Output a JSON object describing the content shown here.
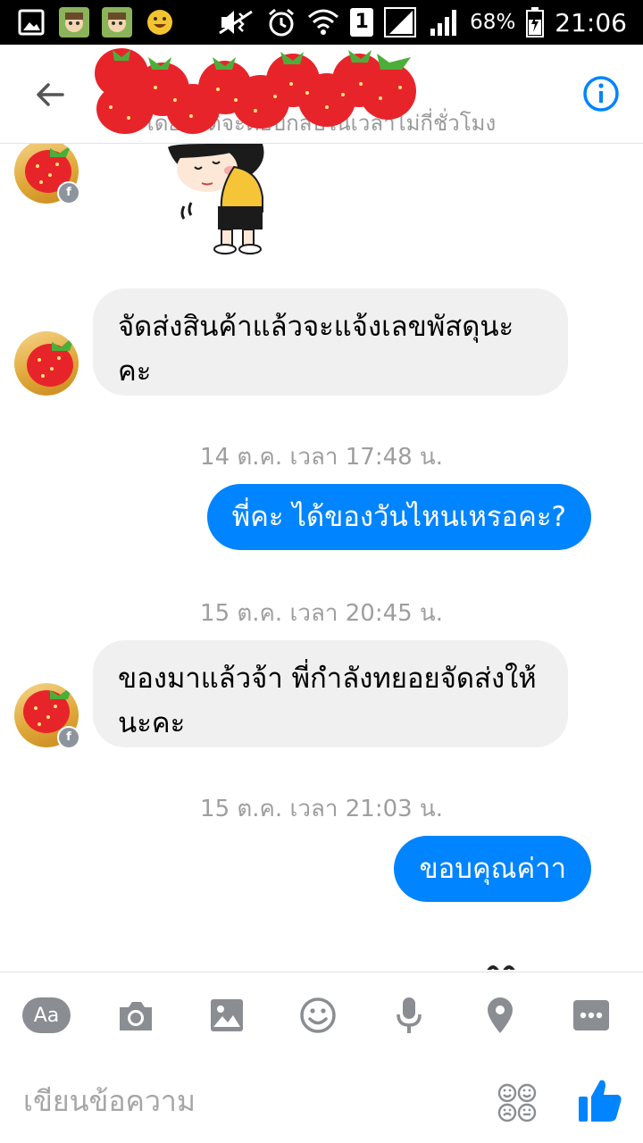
{
  "status_bar": {
    "battery": "68%",
    "time": "21:06",
    "sim": "1"
  },
  "header": {
    "subtitle": "โดยปกติจะตอบกลับในเวลาไม่กี่ชั่วโมง"
  },
  "messages": {
    "m1": "จัดส่งสินค้าแล้วจะแจ้งเลขพัสดุนะคะ",
    "ts1": "14 ต.ค. เวลา 17:48 น.",
    "m2": "พี่คะ ได้ของวันไหนเหรอคะ?",
    "ts2": "15 ต.ค. เวลา 20:45 น.",
    "m3": "ของมาแล้วจ้า พี่กำลังทยอยจัดส่งให้นะคะ",
    "ts3": "15 ต.ค. เวลา 21:03 น.",
    "m4": "ขอบคุณค่าา"
  },
  "composer": {
    "aa_label": "Aa",
    "placeholder": "เขียนข้อความ"
  },
  "colors": {
    "accent": "#0084ff",
    "incoming_bubble": "#f1f0f0",
    "statusbar": "#000000",
    "icon_gray": "#8a8d91"
  },
  "icons": [
    "back-arrow-icon",
    "info-icon",
    "camera-icon",
    "image-icon",
    "emoji-icon",
    "mic-icon",
    "location-icon",
    "more-icon",
    "stickers-icon",
    "thumbs-up-icon"
  ]
}
